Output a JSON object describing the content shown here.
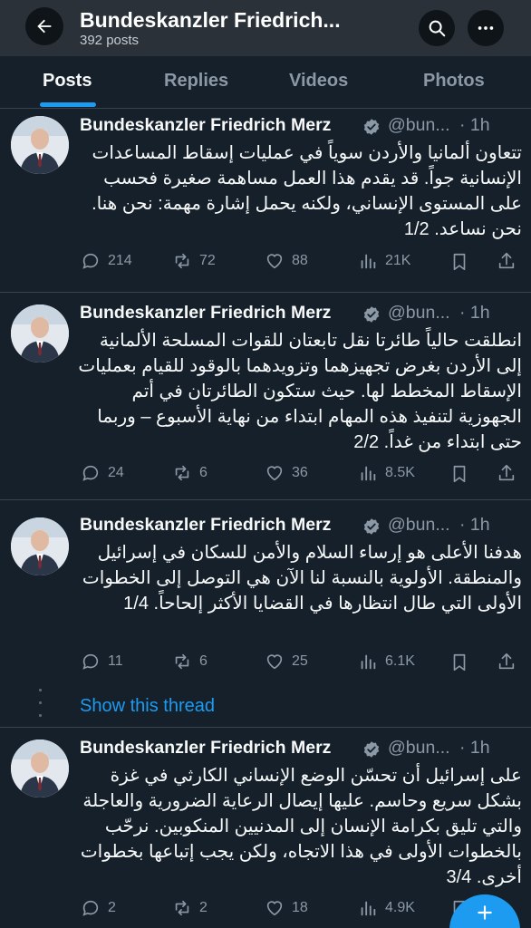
{
  "header": {
    "title": "Bundeskanzler Friedrich...",
    "post_count": "392 posts"
  },
  "tabs": [
    {
      "label": "Posts"
    },
    {
      "label": "Replies"
    },
    {
      "label": "Videos"
    },
    {
      "label": "Photos"
    }
  ],
  "thread_link": "Show this thread",
  "posts": [
    {
      "author": "Bundeskanzler Friedrich Merz",
      "handle": "@bun...",
      "time": "· 1h",
      "text": "تتعاون ألمانيا والأردن سوياً في عمليات إسقاط المساعدات الإنسانية جواً. قد يقدم هذا العمل مساهمة صغيرة فحسب على المستوى الإنساني، ولكنه يحمل إشارة مهمة: نحن هنا. نحن نساعد. 1/2",
      "replies": "214",
      "reposts": "72",
      "likes": "88",
      "views": "21K"
    },
    {
      "author": "Bundeskanzler Friedrich Merz",
      "handle": "@bun...",
      "time": "· 1h",
      "text": "انطلقت حالياً طائرتا نقل تابعتان للقوات المسلحة الألمانية إلى الأردن بغرض تجهيزهما وتزويدهما بالوقود للقيام بعمليات الإسقاط المخطط لها. حيث ستكون الطائرتان في أتم الجهوزية لتنفيذ هذه المهام ابتداء من نهاية الأسبوع – وربما حتى ابتداء من غداً. 2/2",
      "replies": "24",
      "reposts": "6",
      "likes": "36",
      "views": "8.5K"
    },
    {
      "author": "Bundeskanzler Friedrich Merz",
      "handle": "@bun...",
      "time": "· 1h",
      "text": "هدفنا الأعلى هو إرساء السلام والأمن للسكان في إسرائيل والمنطقة. الأولوية بالنسبة لنا الآن هي التوصل إلى الخطوات الأولى التي طال انتظارها في القضايا الأكثر إلحاحاً. 1/4",
      "replies": "11",
      "reposts": "6",
      "likes": "25",
      "views": "6.1K"
    },
    {
      "author": "Bundeskanzler Friedrich Merz",
      "handle": "@bun...",
      "time": "· 1h",
      "text": "على إسرائيل أن تحسّن الوضع الإنساني الكارثي في غزة بشكل سريع وحاسم. عليها إيصال الرعاية الضرورية والعاجلة والتي تليق بكرامة الإنسان إلى المدنيين المنكوبين. نرحّب بالخطوات الأولى في هذا الاتجاه، ولكن يجب إتباعها بخطوات أخرى. 3/4",
      "replies": "2",
      "reposts": "2",
      "likes": "18",
      "views": "4.9K"
    }
  ],
  "colors": {
    "background": "#15202b",
    "accent": "#1d9bf0",
    "muted": "#8b98a5"
  }
}
